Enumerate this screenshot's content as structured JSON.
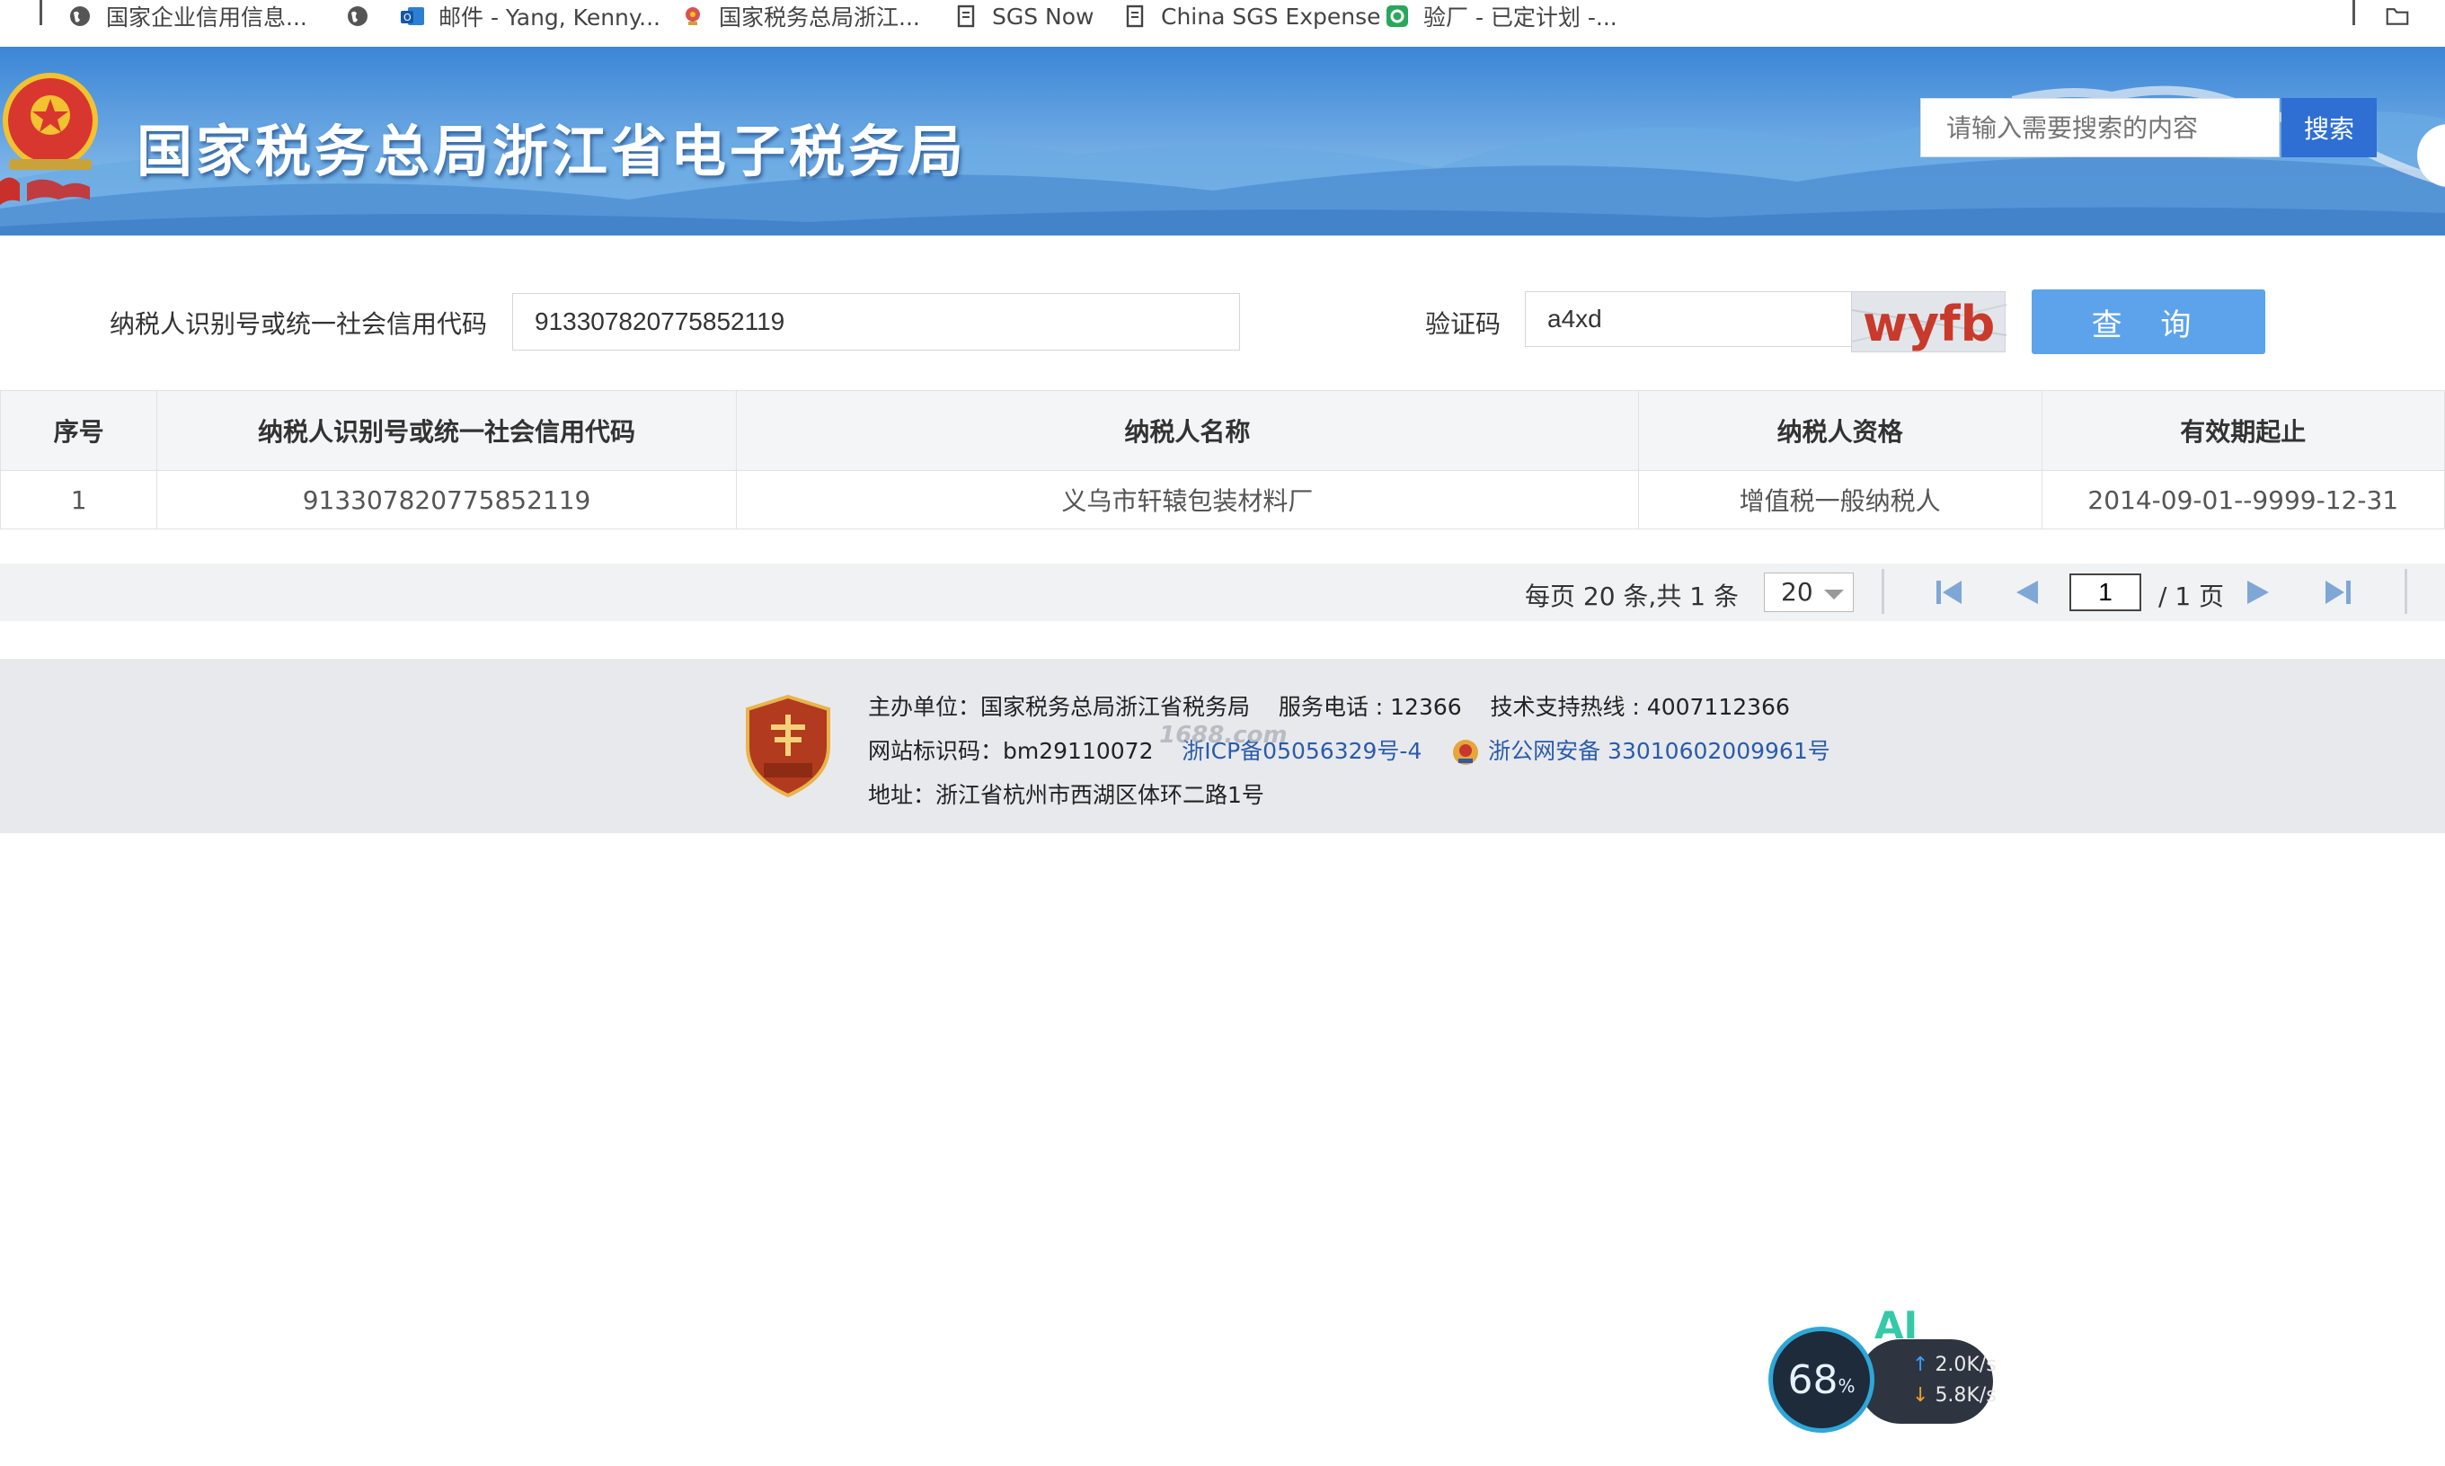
{
  "bookmarks": [
    {
      "label": "国家企业信用信息..."
    },
    {
      "label": "邮件 - Yang, Kenny..."
    },
    {
      "label": "国家税务总局浙江..."
    },
    {
      "label": "SGS Now"
    },
    {
      "label": "China SGS Expense"
    },
    {
      "label": "验厂 - 已定计划 -..."
    }
  ],
  "header": {
    "title": "国家税务总局浙江省电子税务局",
    "search_placeholder": "请输入需要搜索的内容",
    "search_button": "搜索"
  },
  "query": {
    "taxpayer_label": "纳税人识别号或统一社会信用代码",
    "taxpayer_value": "913307820775852119",
    "captcha_label": "验证码",
    "captcha_value": "a4xd",
    "captcha_image_text": "wyfb",
    "query_button": "查 询"
  },
  "table": {
    "columns": [
      "序号",
      "纳税人识别号或统一社会信用代码",
      "纳税人名称",
      "纳税人资格",
      "有效期起止"
    ],
    "rows": [
      [
        "1",
        "913307820775852119",
        "义乌市轩辕包装材料厂",
        "增值税一般纳税人",
        "2014-09-01--9999-12-31"
      ]
    ]
  },
  "pager": {
    "summary": "每页 20 条,共 1 条",
    "page_size": "20",
    "current_page": "1",
    "total_pages": "/ 1 页"
  },
  "footer": {
    "sponsor": "主办单位：国家税务总局浙江省税务局",
    "phone": "服务电话 : 12366",
    "hotline": "技术支持热线 : 4007112366",
    "site_id": "网站标识码：bm29110072",
    "icp": "浙ICP备05056329号-4",
    "police": "浙公网安备 33010602009961号",
    "address": "地址：浙江省杭州市西湖区体环二路1号",
    "watermark": "1688.com"
  },
  "widget": {
    "percent": "68",
    "unit": "%",
    "upload": "2.0",
    "download": "5.8",
    "speed_unit": "K/s",
    "ai_label": "AI"
  },
  "colors": {
    "banner_top": "#2e7dd1",
    "search_button": "#2f6fd3",
    "query_button": "#5ca3ec",
    "link": "#2a5caa"
  }
}
